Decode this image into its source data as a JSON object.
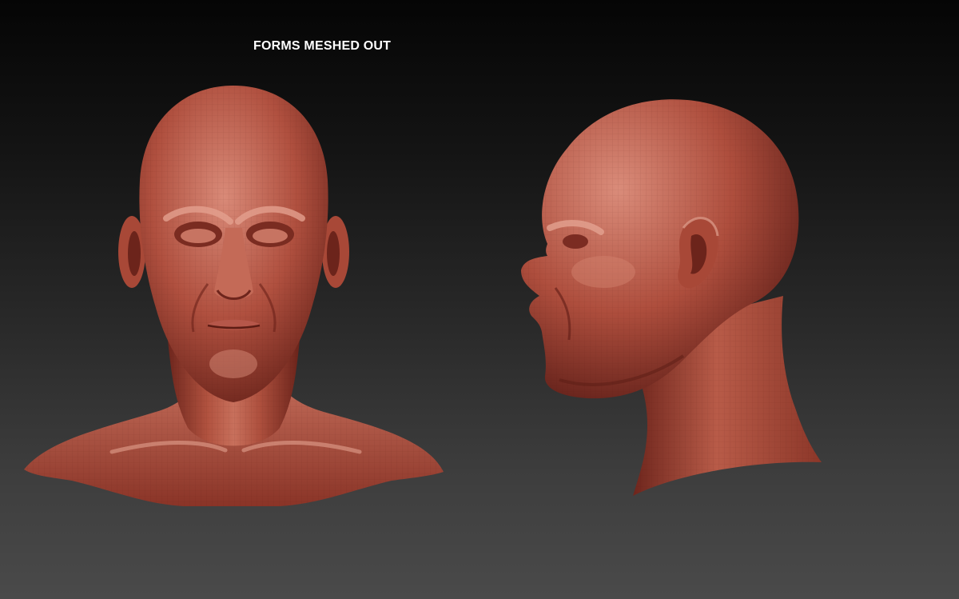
{
  "title": "FORMS MESHED OUT",
  "views": [
    {
      "name": "front",
      "icon": "head-front-render"
    },
    {
      "name": "profile",
      "icon": "head-profile-render"
    }
  ],
  "colors": {
    "clay_base": "#a8453a",
    "clay_light": "#d7826f",
    "clay_dark": "#5e1e17",
    "background_top": "#050505",
    "background_bottom": "#4a4a4a",
    "title_text": "#ffffff"
  }
}
